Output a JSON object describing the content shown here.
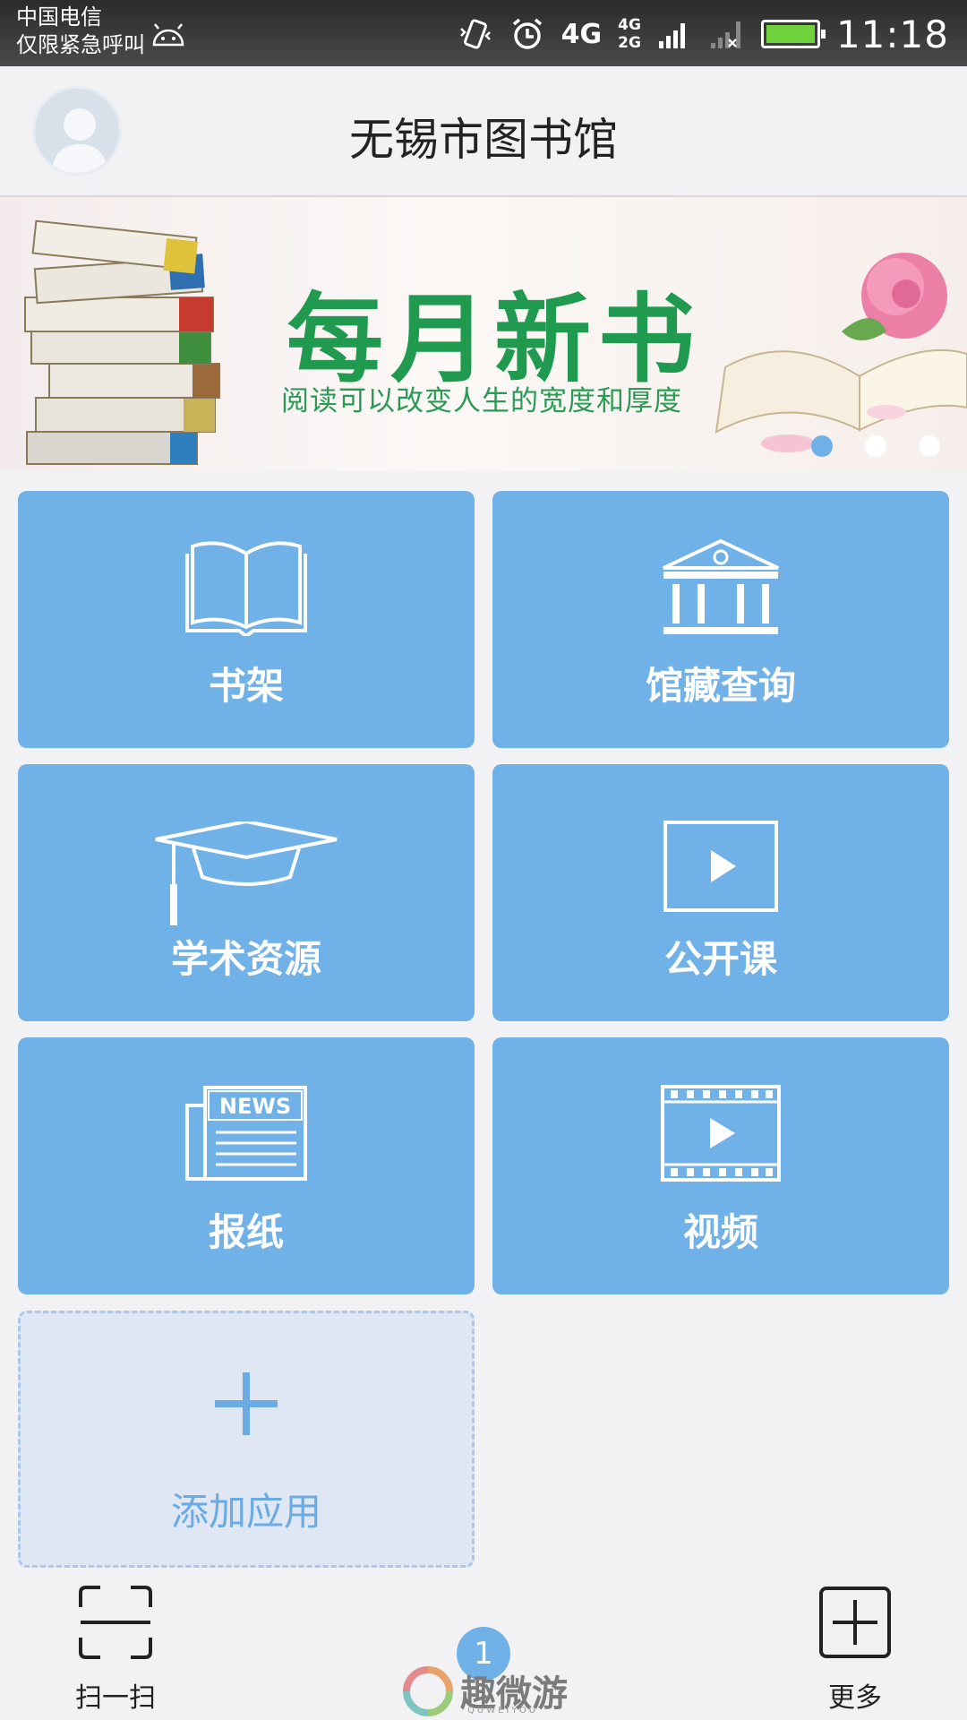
{
  "status_bar": {
    "carrier": "中国电信",
    "emergency": "仅限紧急呼叫",
    "network_primary": "4G",
    "network_secondary_top": "4G",
    "network_secondary_bottom": "2G",
    "time": "11:18"
  },
  "header": {
    "title": "无锡市图书馆"
  },
  "banner": {
    "title": "每月新书",
    "subtitle": "阅读可以改变人生的宽度和厚度",
    "active_slide": 1,
    "slide_count": 3
  },
  "tiles": [
    {
      "label": "书架",
      "icon": "open-book-icon"
    },
    {
      "label": "馆藏查询",
      "icon": "library-building-icon"
    },
    {
      "label": "学术资源",
      "icon": "graduation-cap-icon"
    },
    {
      "label": "公开课",
      "icon": "play-screen-icon"
    },
    {
      "label": "报纸",
      "icon": "newspaper-icon",
      "icon_text": "NEWS"
    },
    {
      "label": "视频",
      "icon": "film-strip-icon"
    }
  ],
  "add_app": {
    "label": "添加应用",
    "icon": "plus-icon"
  },
  "bottom_bar": {
    "scan_label": "扫一扫",
    "more_label": "更多",
    "badge_count": "1"
  },
  "watermark": {
    "text": "趣微游",
    "sub": "QUWEIYOU"
  },
  "colors": {
    "tile": "#70b1e7",
    "accent": "#6fb0e6",
    "banner_green": "#1f9a4f"
  }
}
